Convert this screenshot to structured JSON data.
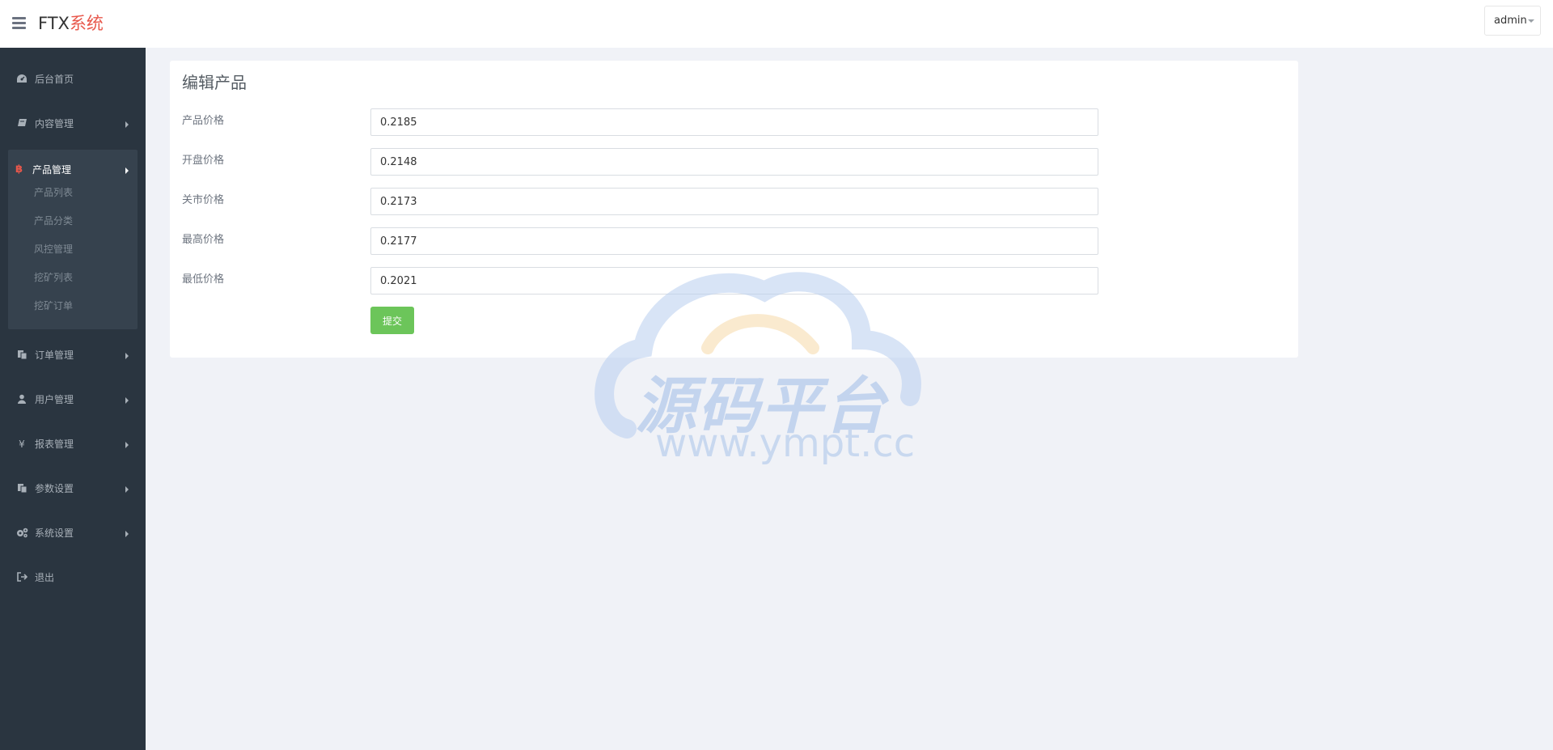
{
  "header": {
    "brand_prefix": "FTX",
    "brand_suffix": "系统",
    "user_label": "admin"
  },
  "sidebar": {
    "items": [
      {
        "label": "后台首页",
        "icon": "dashboard-icon",
        "has_arrow": false
      },
      {
        "label": "内容管理",
        "icon": "book-icon",
        "has_arrow": true
      },
      {
        "label": "产品管理",
        "icon": "bitcoin-icon",
        "has_arrow": true,
        "active": true
      },
      {
        "label": "订单管理",
        "icon": "copy-icon",
        "has_arrow": true
      },
      {
        "label": "用户管理",
        "icon": "user-icon",
        "has_arrow": true
      },
      {
        "label": "报表管理",
        "icon": "yen-icon",
        "has_arrow": true
      },
      {
        "label": "参数设置",
        "icon": "copy-icon",
        "has_arrow": true
      },
      {
        "label": "系统设置",
        "icon": "gears-icon",
        "has_arrow": true
      },
      {
        "label": "退出",
        "icon": "sign-out-icon",
        "has_arrow": false
      }
    ],
    "active_subitems": [
      "产品列表",
      "产品分类",
      "风控管理",
      "挖矿列表",
      "挖矿订单"
    ]
  },
  "main": {
    "title": "编辑产品",
    "fields": [
      {
        "label": "产品价格",
        "value": "0.2185"
      },
      {
        "label": "开盘价格",
        "value": "0.2148"
      },
      {
        "label": "关市价格",
        "value": "0.2173"
      },
      {
        "label": "最高价格",
        "value": "0.2177"
      },
      {
        "label": "最低价格",
        "value": "0.2021"
      }
    ],
    "submit_label": "提交"
  },
  "watermark": {
    "text": "源码平台",
    "url": "www.ympt.cc"
  },
  "colors": {
    "sidebar_bg": "#2a3540",
    "accent_red": "#e8574b",
    "submit_green": "#6cc55a",
    "page_bg": "#f0f2f7"
  }
}
